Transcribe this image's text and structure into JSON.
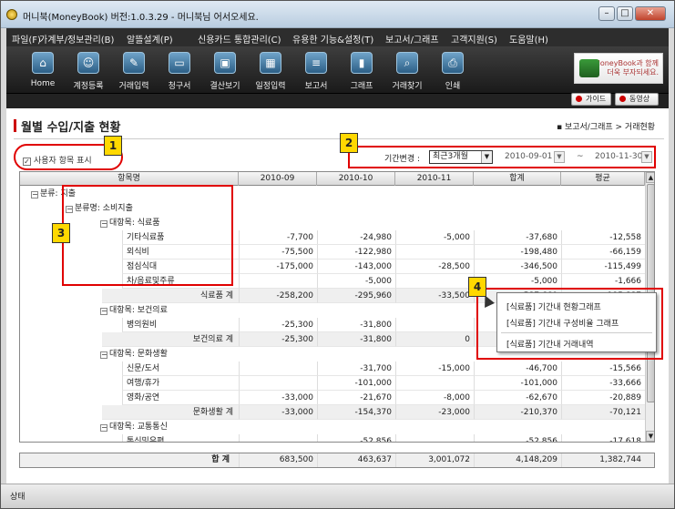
{
  "window": {
    "title": "머니북(MoneyBook) 버전:1.0.3.29 - 머니북님 어서오세요."
  },
  "menu": [
    "파일(F)",
    "가계부/정보관리(B)",
    "알뜰설계(P)",
    "신용카드 통합관리(C)",
    "유용한 기능&설정(T)",
    "보고서/그래프",
    "고객지원(S)",
    "도움말(H)"
  ],
  "toolbar": [
    {
      "label": "Home",
      "icon": "home-icon"
    },
    {
      "label": "계정등록",
      "icon": "account-icon"
    },
    {
      "label": "거래입력",
      "icon": "edit-icon"
    },
    {
      "label": "청구서",
      "icon": "card-icon"
    },
    {
      "label": "결산보기",
      "icon": "monitor-icon"
    },
    {
      "label": "일정입력",
      "icon": "calendar-icon"
    },
    {
      "label": "보고서",
      "icon": "report-icon"
    },
    {
      "label": "그래프",
      "icon": "chart-icon"
    },
    {
      "label": "거래찾기",
      "icon": "search-icon"
    },
    {
      "label": "인쇄",
      "icon": "print-icon"
    }
  ],
  "brand": {
    "line1": "MoneyBook과 함께",
    "line2": "더욱 부자되세요."
  },
  "subbar": {
    "guide": "가이드",
    "video": "동영상"
  },
  "page": {
    "title": "월별 수입/지출 현황",
    "breadcrumb": "▪ 보고서/그래프 > 거래현황"
  },
  "filters": {
    "user_items_label": "사용자 항목 표시",
    "period_label": "기간변경 :",
    "period_value": "최근3개월",
    "date_from": "2010-09-01",
    "tilde": "~",
    "date_to": "2010-11-30"
  },
  "table": {
    "columns": [
      "항목명",
      "2010-09",
      "2010-10",
      "2010-11",
      "합계",
      "평균"
    ],
    "rows": [
      {
        "kind": "group",
        "label": "분류: 지출",
        "indent": 0
      },
      {
        "kind": "group",
        "label": "분류명: 소비지출",
        "indent": 1
      },
      {
        "kind": "group",
        "label": "대항목: 식료품",
        "indent": 2
      },
      {
        "kind": "item",
        "label": "기타식료품",
        "values": [
          "-7,700",
          "-24,980",
          "-5,000",
          "-37,680",
          "-12,558"
        ]
      },
      {
        "kind": "item",
        "label": "외식비",
        "values": [
          "-75,500",
          "-122,980",
          "",
          "-198,480",
          "-66,159"
        ]
      },
      {
        "kind": "item",
        "label": "점심식대",
        "values": [
          "-175,000",
          "-143,000",
          "-28,500",
          "-346,500",
          "-115,499"
        ]
      },
      {
        "kind": "item",
        "label": "차/음료및주류",
        "values": [
          "",
          "-5,000",
          "",
          "-5,000",
          "-1,666"
        ]
      },
      {
        "kind": "subtotal",
        "label": "식료품 계",
        "values": [
          "-258,200",
          "-295,960",
          "-33,500",
          "-587,660",
          "-195,887"
        ]
      },
      {
        "kind": "group",
        "label": "대항목: 보건의료",
        "indent": 2
      },
      {
        "kind": "item",
        "label": "병의원비",
        "values": [
          "-25,300",
          "-31,800",
          "",
          "",
          ""
        ]
      },
      {
        "kind": "subtotal",
        "label": "보건의료 계",
        "values": [
          "-25,300",
          "-31,800",
          "0",
          "",
          ""
        ]
      },
      {
        "kind": "group",
        "label": "대항목: 문화생활",
        "indent": 2
      },
      {
        "kind": "item",
        "label": "신문/도서",
        "values": [
          "",
          "-31,700",
          "-15,000",
          "-46,700",
          "-15,566"
        ]
      },
      {
        "kind": "item",
        "label": "여행/휴가",
        "values": [
          "",
          "-101,000",
          "",
          "-101,000",
          "-33,666"
        ]
      },
      {
        "kind": "item",
        "label": "영화/공연",
        "values": [
          "-33,000",
          "-21,670",
          "-8,000",
          "-62,670",
          "-20,889"
        ]
      },
      {
        "kind": "subtotal",
        "label": "문화생활 계",
        "values": [
          "-33,000",
          "-154,370",
          "-23,000",
          "-210,370",
          "-70,121"
        ]
      },
      {
        "kind": "group",
        "label": "대항목: 교통통신",
        "indent": 2
      },
      {
        "kind": "item",
        "label": "통신및우편",
        "values": [
          "",
          "-52,856",
          "",
          "-52,856",
          "-17,618"
        ]
      }
    ],
    "total": {
      "label": "합 계",
      "values": [
        "683,500",
        "463,637",
        "3,001,072",
        "4,148,209",
        "1,382,744"
      ]
    }
  },
  "context_menu": [
    "[식료품] 기간내 현황그래프",
    "[식료품] 기간내 구성비율 그래프",
    "[식료품] 기간내 거래내역"
  ],
  "annotations": [
    "1",
    "2",
    "3",
    "4"
  ],
  "status": "상태"
}
